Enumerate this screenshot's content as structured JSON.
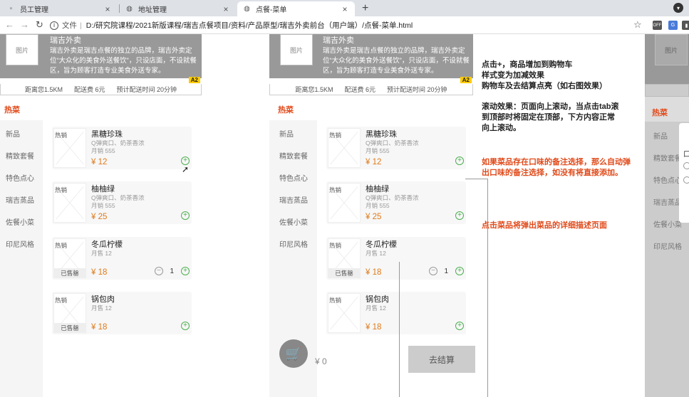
{
  "browser": {
    "tabs": [
      {
        "title": "员工管理",
        "close": "×"
      },
      {
        "title": "地址管理",
        "close": "×"
      },
      {
        "title": "点餐-菜单",
        "close": "×"
      }
    ],
    "new_tab": "+",
    "address": {
      "scheme_label": "文件",
      "separator": "|",
      "url": "D:/研究院课程/2021新版课程/瑞吉点餐项目/资料/产品原型/瑞吉外卖前台（用户端）/点餐-菜单.html"
    },
    "extensions": [
      {
        "label": "OFF",
        "color": "#555555"
      },
      {
        "label": "G",
        "color": "#4a7bd9"
      },
      {
        "label": "▮",
        "color": "#555555"
      }
    ]
  },
  "shop": {
    "image_label": "图片",
    "name": "瑞吉外卖",
    "description": "瑞吉外卖是瑞吉点餐的独立的品牌，瑞吉外卖定位“大众化的美食外送餐饮”，只设店面，不设就餐区，旨为顾客打造专业美食外送专家。",
    "badge": "A2",
    "distance": "距离您1.5KM",
    "delivery_fee": "配送费 6元",
    "delivery_time": "预计配送时间 20分钟"
  },
  "menu": {
    "section_title": "热菜",
    "categories": [
      "新品",
      "精致套餐",
      "特色点心",
      "瑞吉蒸品",
      "佐餐小菜",
      "印尼风格"
    ],
    "items": [
      {
        "tag": "热销",
        "name": "黑糖珍珠",
        "desc": "Q弹爽口、奶茶香浓",
        "sales": "月销 555",
        "price": "¥ 12",
        "sold_out": ""
      },
      {
        "tag": "热销",
        "name": "柚柚绿",
        "desc": "Q弹爽口、奶茶香浓",
        "sales": "月销 555",
        "price": "¥ 25",
        "sold_out": ""
      },
      {
        "tag": "热销",
        "name": "冬瓜柠檬",
        "desc": "",
        "sales": "月售 12",
        "price": "¥ 18",
        "sold_out": "已售罄"
      },
      {
        "tag": "热销",
        "name": "锅包肉",
        "desc": "",
        "sales": "月售 12",
        "price": "¥ 18",
        "sold_out": "已售罄"
      }
    ],
    "stepper": {
      "minus": "−",
      "plus": "+",
      "qty": "1"
    }
  },
  "cart": {
    "total": "¥ 0",
    "checkout_label": "去结算"
  },
  "annotations": {
    "a1": "点击+，商品增加到购物车\n样式变为加减效果\n购物车及去结算点亮（如右图效果）",
    "a2": "滚动效果：页面向上滚动，当点击tab滚\n到顶部时将固定在顶部，下方内容正常\n向上滚动。",
    "a3": "如果菜品存在口味的备注选择，那么自动弹\n出口味的备注选择，如没有将直接添加。",
    "a4": "点击菜品将弹出菜品的详细描述页面"
  },
  "right_panel": {
    "image_label": "图片",
    "section_title": "热菜",
    "categories": [
      "新品",
      "精致套餐",
      "特色点心",
      "瑞吉蒸品",
      "佐餐小菜",
      "印尼风格"
    ],
    "popup_label": "口"
  }
}
